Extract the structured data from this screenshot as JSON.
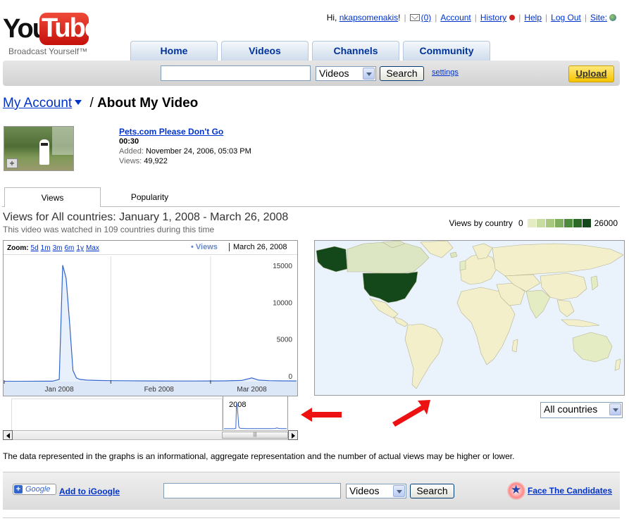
{
  "header": {
    "logo_you": "You",
    "logo_tube": "Tube",
    "tagline": "Broadcast Yourself™",
    "greeting": "Hi,",
    "username": "nkapsomenakis",
    "greeting_end": "!",
    "inbox_count": "(0)",
    "links": {
      "account": "Account",
      "history": "History",
      "help": "Help",
      "logout": "Log Out",
      "site": "Site:"
    }
  },
  "nav": {
    "home": "Home",
    "videos": "Videos",
    "channels": "Channels",
    "community": "Community"
  },
  "search": {
    "value": "",
    "category": "Videos",
    "button": "Search",
    "settings": "settings",
    "upload": "Upload"
  },
  "title": {
    "account": "My Account",
    "separator": "/",
    "current": "About My Video"
  },
  "video": {
    "title": "Pets.com Please Don't Go",
    "duration": "00:30",
    "added_label": "Added:",
    "added": "November 24, 2006, 05:03 PM",
    "views_label": "Views:",
    "views": "49,922"
  },
  "tabs": {
    "views": "Views",
    "popularity": "Popularity"
  },
  "stats": {
    "heading": "Views for All countries: January 1, 2008 - March 26, 2008",
    "subheading": "This video was watched in 109 countries during this time"
  },
  "legend": {
    "label": "Views by country",
    "min": "0",
    "max": "26000",
    "colors": [
      "#e4ecc4",
      "#c8dca0",
      "#a8c880",
      "#7fae5e",
      "#4d8a3c",
      "#2a6a24",
      "#14481a"
    ]
  },
  "chart": {
    "zoom_label": "Zoom:",
    "zoom_options": [
      "5d",
      "1m",
      "3m",
      "6m",
      "1y",
      "Max"
    ],
    "series_label": "• Views",
    "date": "March 26, 2008",
    "overview_label": "2008"
  },
  "chart_data": {
    "type": "line",
    "title": "",
    "xlabel": "",
    "ylabel": "",
    "x_tick_labels": [
      "Jan 2008",
      "Feb 2008",
      "Mar 2008"
    ],
    "y_tick_labels": [
      "15000",
      "10000",
      "5000",
      "0"
    ],
    "ylim": [
      0,
      17000
    ],
    "xlim": [
      "2008-01-01",
      "2008-03-26"
    ],
    "grid": true,
    "series": [
      {
        "name": "Views",
        "x": [
          "2008-01-01",
          "2008-01-05",
          "2008-01-10",
          "2008-01-15",
          "2008-01-17",
          "2008-01-18",
          "2008-01-19",
          "2008-01-20",
          "2008-01-21",
          "2008-01-22",
          "2008-01-23",
          "2008-01-25",
          "2008-01-28",
          "2008-02-01",
          "2008-02-05",
          "2008-02-10",
          "2008-02-15",
          "2008-02-20",
          "2008-02-25",
          "2008-03-01",
          "2008-03-05",
          "2008-03-10",
          "2008-03-13",
          "2008-03-15",
          "2008-03-18",
          "2008-03-22",
          "2008-03-26"
        ],
        "y": [
          40,
          40,
          50,
          60,
          300,
          15800,
          14000,
          8000,
          1500,
          500,
          300,
          200,
          150,
          120,
          110,
          100,
          90,
          80,
          80,
          90,
          100,
          150,
          500,
          200,
          120,
          100,
          90
        ]
      }
    ]
  },
  "map": {
    "filter": "All countries"
  },
  "disclaimer": "The data represented in the graphs is an informational, aggregate representation and the number of actual views may be higher or lower.",
  "footer": {
    "google": "Google",
    "add_igoogle": "Add to iGoogle",
    "search_value": "",
    "category": "Videos",
    "button": "Search",
    "face_candidates": "Face The Candidates"
  }
}
